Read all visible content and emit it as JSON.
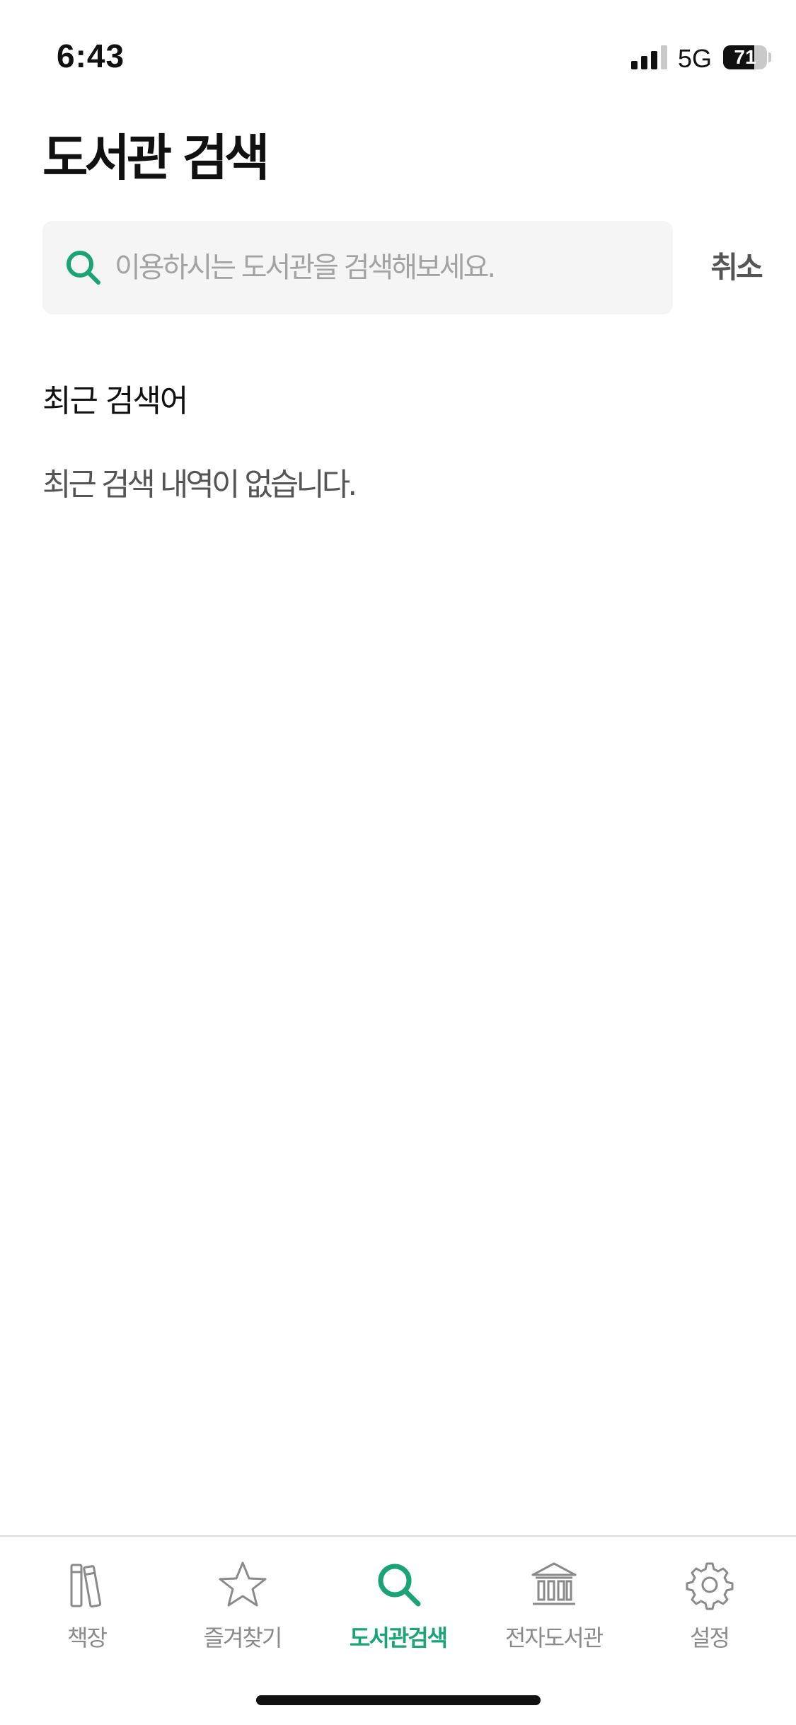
{
  "status_bar": {
    "time": "6:43",
    "network": "5G",
    "battery": "71",
    "battery_level_percent": 71
  },
  "header": {
    "title": "도서관 검색"
  },
  "search": {
    "placeholder": "이용하시는 도서관을 검색해보세요.",
    "value": "",
    "cancel_label": "취소",
    "icon": "search-icon"
  },
  "recent": {
    "heading": "최근 검색어",
    "empty_message": "최근 검색 내역이 없습니다."
  },
  "tab_bar": {
    "active_tab": "도서관검색",
    "items": [
      {
        "label": "책장",
        "icon": "bookshelf-icon"
      },
      {
        "label": "즐겨찾기",
        "icon": "star-icon"
      },
      {
        "label": "도서관검색",
        "icon": "search-icon"
      },
      {
        "label": "전자도서관",
        "icon": "library-building-icon"
      },
      {
        "label": "설정",
        "icon": "gear-icon"
      }
    ]
  },
  "colors": {
    "accent": "#1aa377",
    "inactive": "#8a8a8a",
    "search_background": "#f5f5f5",
    "placeholder": "#a3a3a3"
  }
}
